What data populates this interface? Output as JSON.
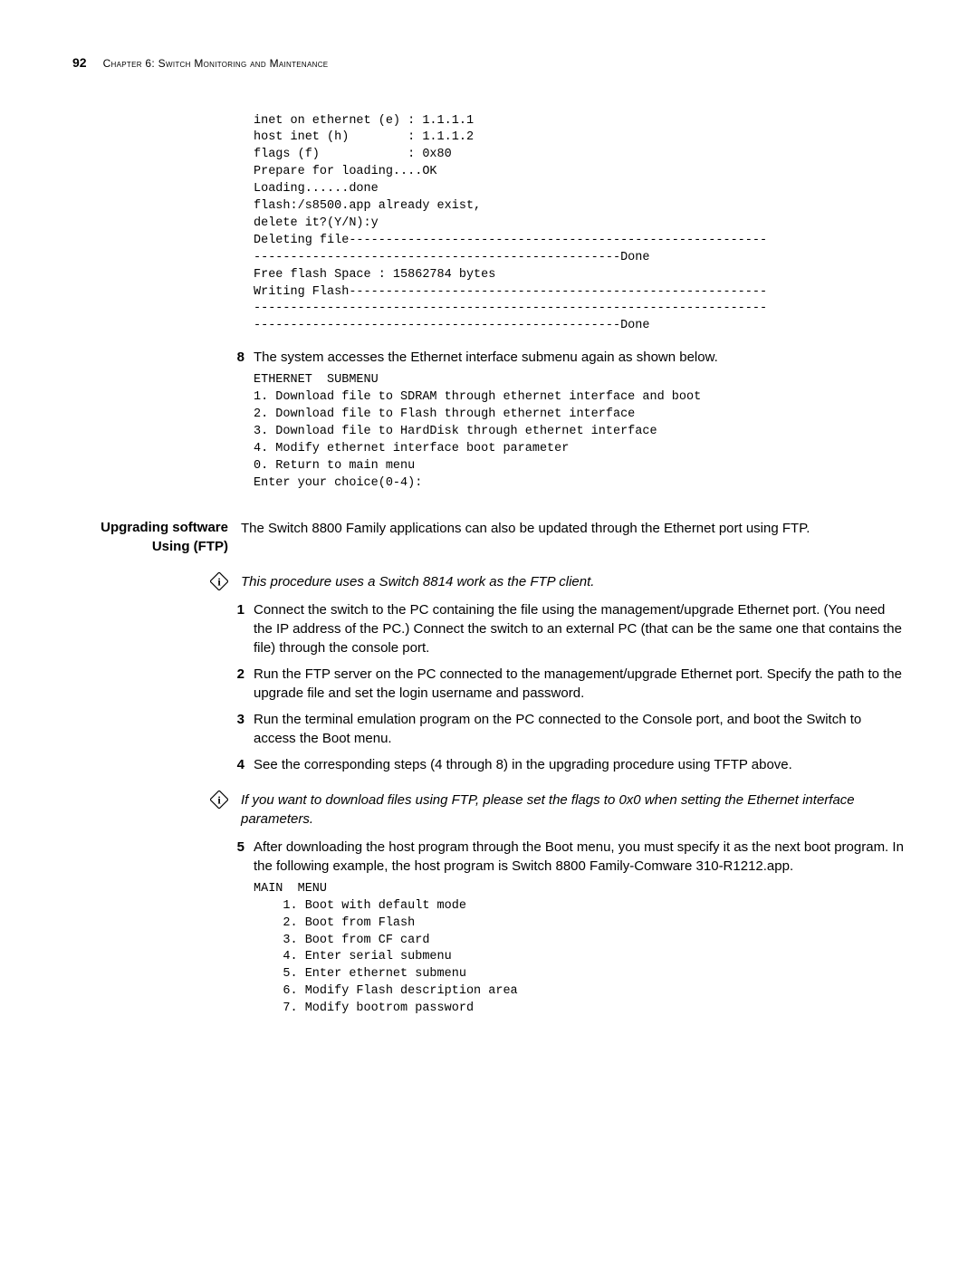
{
  "header": {
    "page_number": "92",
    "chapter": "Chapter 6: Switch Monitoring and Maintenance"
  },
  "code1": "inet on ethernet (e) : 1.1.1.1\nhost inet (h)        : 1.1.1.2\nflags (f)            : 0x80\nPrepare for loading....OK\nLoading......done\nflash:/s8500.app already exist,\ndelete it?(Y/N):y\nDeleting file---------------------------------------------------------\n--------------------------------------------------Done\nFree flash Space : 15862784 bytes\nWriting Flash---------------------------------------------------------\n----------------------------------------------------------------------\n--------------------------------------------------Done",
  "step8": {
    "num": "8",
    "text": "The system accesses the Ethernet interface submenu again as shown below."
  },
  "code2": "ETHERNET  SUBMENU\n1. Download file to SDRAM through ethernet interface and boot\n2. Download file to Flash through ethernet interface\n3. Download file to HardDisk through ethernet interface\n4. Modify ethernet interface boot parameter\n0. Return to main menu\nEnter your choice(0-4):",
  "section": {
    "label": "Upgrading software Using (FTP)",
    "body": "The Switch 8800 Family applications can also be updated through the Ethernet port using FTP."
  },
  "info1": "This procedure uses a Switch 8814 work as the FTP client.",
  "steps": {
    "s1": {
      "num": "1",
      "text": "Connect the switch to the PC containing the file using the management/upgrade Ethernet port. (You need the IP address of the PC.) Connect the switch to an external PC (that can be the same one that contains the file) through the console port."
    },
    "s2": {
      "num": "2",
      "text": "Run the FTP server on the PC connected to the management/upgrade Ethernet port. Specify the path to the upgrade file and set the login username and password."
    },
    "s3": {
      "num": "3",
      "text": "Run the terminal emulation program on the PC connected to the Console port, and boot the Switch to access the Boot menu."
    },
    "s4": {
      "num": "4",
      "text": "See the corresponding steps (4 through 8) in the upgrading procedure using TFTP above."
    },
    "s5": {
      "num": "5",
      "text": "After downloading the host program through the Boot menu, you must specify it as the next boot program. In the following example, the host program is Switch 8800 Family-Comware 310-R1212.app."
    }
  },
  "info2": " If you want to download files using FTP, please set the flags to 0x0 when setting the Ethernet interface parameters.",
  "code3": "MAIN  MENU\n    1. Boot with default mode\n    2. Boot from Flash\n    3. Boot from CF card\n    4. Enter serial submenu\n    5. Enter ethernet submenu\n    6. Modify Flash description area\n    7. Modify bootrom password"
}
